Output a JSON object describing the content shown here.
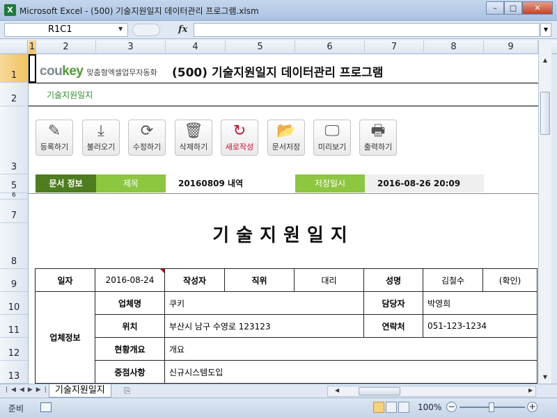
{
  "window": {
    "title": "Microsoft Excel - (500) 기술지원일지 데이터관리 프로그램.xlsm",
    "app_letter": "X",
    "controls": {
      "minimize": "–",
      "maximize": "□",
      "close": "✕"
    }
  },
  "formula_bar": {
    "name_box": "R1C1",
    "fx": "fx",
    "content": ""
  },
  "columns": [
    "1",
    "2",
    "3",
    "4",
    "5",
    "6",
    "7",
    "8",
    "9"
  ],
  "rows": [
    "1",
    "2",
    "3",
    "5",
    "6",
    "7",
    "8",
    "9",
    "10",
    "11",
    "12",
    "13"
  ],
  "header": {
    "logo_prefix": "cou",
    "logo_accent": "key",
    "logo_tagline": "맞춤형엑셀업무자동화",
    "title": "(500) 기술지원일지 데이터관리 프로그램",
    "subtitle": "기술지원일지"
  },
  "toolbar": [
    {
      "label": "등록하기",
      "icon": "✎",
      "icon_name": "pencil-icon"
    },
    {
      "label": "불러오기",
      "icon": "⤓",
      "icon_name": "download-icon"
    },
    {
      "label": "수정하기",
      "icon": "⟳",
      "icon_name": "refresh-icon"
    },
    {
      "label": "삭제하기",
      "icon": "🗑",
      "icon_name": "trash-icon"
    },
    {
      "label": "새로작성",
      "icon": "↻",
      "icon_name": "new-icon"
    },
    {
      "label": "문서저장",
      "icon": "📂",
      "icon_name": "folder-upload-icon"
    },
    {
      "label": "미리보기",
      "icon": "🖵",
      "icon_name": "monitor-icon"
    },
    {
      "label": "출력하기",
      "icon": "🖶",
      "icon_name": "printer-icon"
    }
  ],
  "doc_info": {
    "section_label": "문서 정보",
    "title_label": "제목",
    "title_value": "20160809 내역",
    "saved_label": "저장일시",
    "saved_value": "2016-08-26 20:09"
  },
  "document": {
    "title": "기술지원일지",
    "date_label": "일자",
    "date_value": "2016-08-24",
    "author_label": "작성자",
    "position_label": "직위",
    "position_value": "대리",
    "name_label": "성명",
    "name_value": "김철수",
    "confirm": "(확인)",
    "company_group": "업체정보",
    "company_label": "업체명",
    "company_value": "쿠키",
    "manager_label": "담당자",
    "manager_value": "박영희",
    "location_label": "위치",
    "location_value": "부산시 남구 수영로 123123",
    "contact_label": "연락처",
    "contact_value": "051-123-1234",
    "overview_label": "현황개요",
    "overview_value": "개요",
    "focus_label": "중점사항",
    "focus_value": "신규시스템도입"
  },
  "sheet_tabs": {
    "active": "기술지원일지"
  },
  "status_bar": {
    "status": "준비",
    "zoom": "100%"
  },
  "colors": {
    "accent_dark_green": "#4e7d1f",
    "accent_light_green": "#8dc63f",
    "subtitle_green": "#2e8b2e",
    "new_button_red": "#c8102e"
  }
}
